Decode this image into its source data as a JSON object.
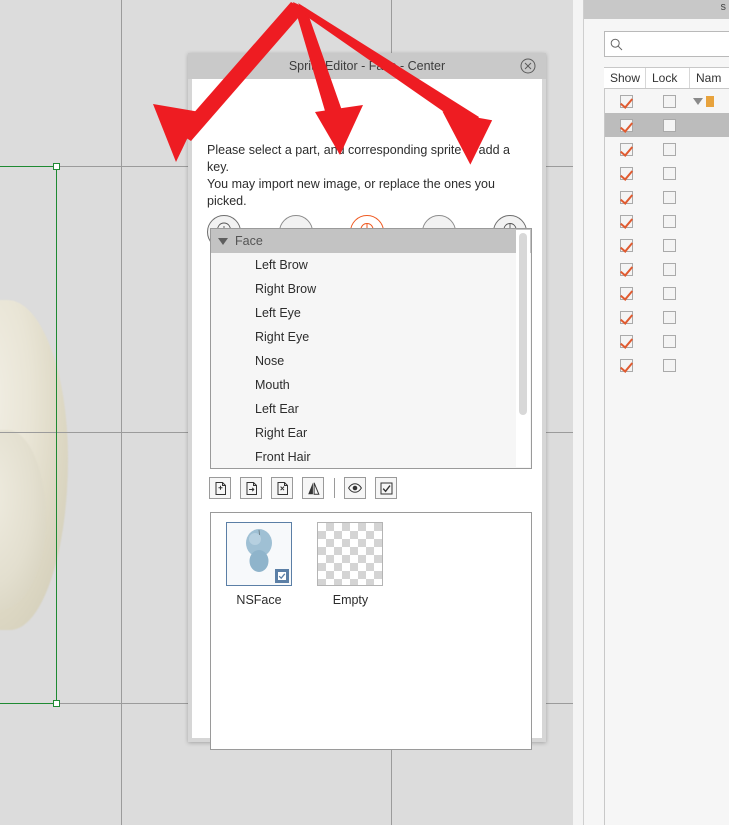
{
  "window": {
    "dialog_title": "Sprite Editor - Face - Center",
    "close_icon": "close-circle-icon"
  },
  "dialog": {
    "description_line_1": "Please select a part, and corresponding sprite to add a",
    "description_line_2": "key.",
    "description_line_3": "You may import new image, or replace the ones you",
    "description_line_4": "picked.",
    "accent_color": "#ef5a22",
    "parts": [
      {
        "name": "face-side-icon",
        "state": "outline",
        "label": ""
      },
      {
        "name": "part-empty-icon",
        "state": "empty",
        "label": ""
      },
      {
        "name": "face-front-icon",
        "state": "selected",
        "label": ""
      },
      {
        "name": "part-empty-icon",
        "state": "empty",
        "label": ""
      },
      {
        "name": "face-angle-icon",
        "state": "outline",
        "label": ""
      }
    ],
    "list": {
      "group_label": "Face",
      "items": [
        "Left Brow",
        "Right Brow",
        "Left Eye",
        "Right Eye",
        "Nose",
        "Mouth",
        "Left Ear",
        "Right Ear",
        "Front Hair"
      ]
    },
    "tools": [
      {
        "name": "import-image-button",
        "icon": "document-plus-icon"
      },
      {
        "name": "replace-image-button",
        "icon": "document-replace-icon"
      },
      {
        "name": "delete-image-button",
        "icon": "document-delete-icon"
      },
      {
        "name": "mirror-button",
        "icon": "mirror-flip-icon"
      },
      {
        "name": "visibility-button",
        "icon": "eye-icon"
      },
      {
        "name": "select-all-button",
        "icon": "checkbox-checked-icon"
      }
    ],
    "sprites": [
      {
        "label": "NSFace",
        "selected": true,
        "kind": "head"
      },
      {
        "label": "Empty",
        "selected": false,
        "kind": "checker"
      }
    ]
  },
  "right_panel": {
    "title": "s",
    "search": {
      "value": "",
      "placeholder": "",
      "icon": "search-icon"
    },
    "columns": [
      "Show",
      "Lock",
      "Nam"
    ],
    "rows": [
      {
        "show": true,
        "lock": false,
        "selected": false,
        "expander": true
      },
      {
        "show": true,
        "lock": false,
        "selected": true,
        "expander": false
      },
      {
        "show": true,
        "lock": false,
        "selected": false,
        "expander": false
      },
      {
        "show": true,
        "lock": false,
        "selected": false,
        "expander": false
      },
      {
        "show": true,
        "lock": false,
        "selected": false,
        "expander": false
      },
      {
        "show": true,
        "lock": false,
        "selected": false,
        "expander": false
      },
      {
        "show": true,
        "lock": false,
        "selected": false,
        "expander": false
      },
      {
        "show": true,
        "lock": false,
        "selected": false,
        "expander": false
      },
      {
        "show": true,
        "lock": false,
        "selected": false,
        "expander": false
      },
      {
        "show": true,
        "lock": false,
        "selected": false,
        "expander": false
      },
      {
        "show": true,
        "lock": false,
        "selected": false,
        "expander": false
      },
      {
        "show": true,
        "lock": false,
        "selected": false,
        "expander": false
      }
    ],
    "check_color": "#e05b30"
  },
  "viewport": {
    "selection_color": "#1e8a32",
    "background_color": "#dcdcdc",
    "grid_color": "#9b9b9b"
  },
  "annotations": {
    "arrow_color": "#ee1c22",
    "arrows": [
      {
        "name": "arrow-to-first-part"
      },
      {
        "name": "arrow-to-last-part"
      }
    ]
  }
}
